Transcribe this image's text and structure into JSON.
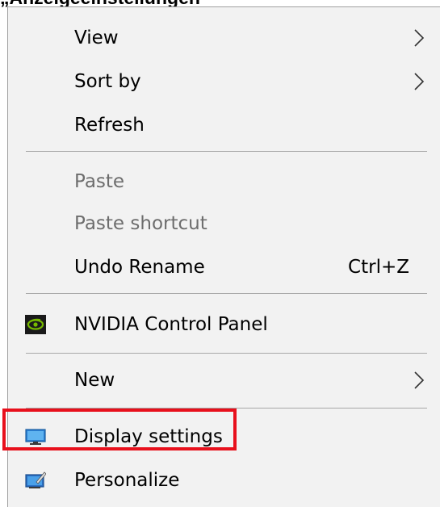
{
  "heading": "„Anzeigeeinstellungen\"",
  "menu": {
    "items": [
      {
        "label": "View",
        "has_submenu": true,
        "disabled": false
      },
      {
        "label": "Sort by",
        "has_submenu": true,
        "disabled": false
      },
      {
        "label": "Refresh",
        "has_submenu": false,
        "disabled": false
      },
      {
        "label": "Paste",
        "has_submenu": false,
        "disabled": true
      },
      {
        "label": "Paste shortcut",
        "has_submenu": false,
        "disabled": true
      },
      {
        "label": "Undo Rename",
        "shortcut": "Ctrl+Z",
        "has_submenu": false,
        "disabled": false
      },
      {
        "label": "NVIDIA Control Panel",
        "icon": "nvidia-icon",
        "has_submenu": false,
        "disabled": false
      },
      {
        "label": "New",
        "has_submenu": true,
        "disabled": false
      },
      {
        "label": "Display settings",
        "icon": "display-icon",
        "has_submenu": false,
        "disabled": false,
        "highlighted": true
      },
      {
        "label": "Personalize",
        "icon": "personalize-icon",
        "has_submenu": false,
        "disabled": false
      }
    ]
  },
  "colors": {
    "menu_background": "#f2f2f2",
    "highlight_border": "#e8101c",
    "disabled_text": "#6d6d6d",
    "nvidia_green": "#76b900"
  }
}
